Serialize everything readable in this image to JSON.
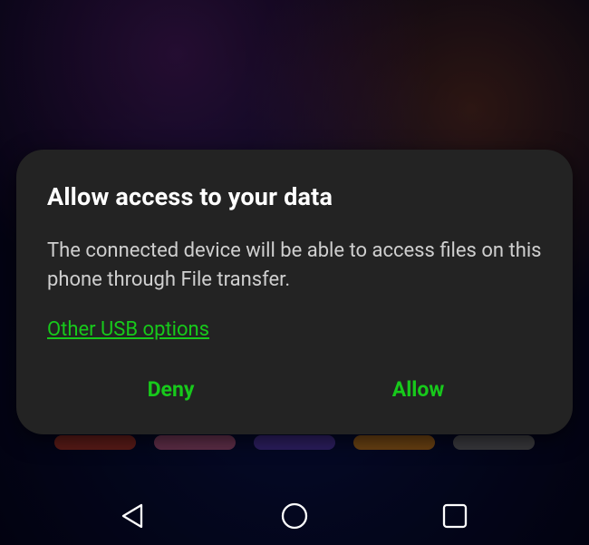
{
  "dialog": {
    "title": "Allow access to your data",
    "body": "The connected device will be able to access files on this phone through File transfer.",
    "link": "Other USB options",
    "deny": "Deny",
    "allow": "Allow"
  },
  "colors": {
    "accent": "#17c91b",
    "dialog_bg": "#232323"
  }
}
